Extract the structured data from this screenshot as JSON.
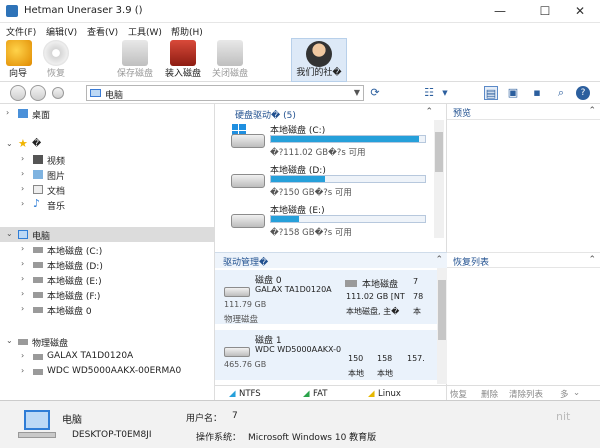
{
  "window": {
    "title": "Hetman Uneraser 3.9 ()",
    "min": "—",
    "max": "☐",
    "close": "✕"
  },
  "menu": [
    "文件(F)",
    "编辑(V)",
    "查看(V)",
    "工具(W)",
    "帮助(H)"
  ],
  "toolbar": {
    "wizard": "向导",
    "recover": "恢复",
    "save_disk": "保存磁盘",
    "load_disk": "装入磁盘",
    "close_disk": "关闭磁盘",
    "community": "我们的社�"
  },
  "address": {
    "value": "电脑"
  },
  "tree": {
    "desktop": "桌面",
    "favorites": "�",
    "videos": "视频",
    "pictures": "图片",
    "documents": "文档",
    "music": "音乐",
    "computer": "电脑",
    "drives": [
      "本地磁盘 (C:)",
      "本地磁盘 (D:)",
      "本地磁盘 (E:)",
      "本地磁盘 (F:)",
      "本地磁盘 0"
    ],
    "physical": "物理磁盘",
    "physical_items": [
      "GALAX TA1D0120A",
      "WDC WD5000AAKX-00ERMA0"
    ]
  },
  "hdd_section": {
    "title": "硬盘驱动� (5)"
  },
  "drives": [
    {
      "name": "本地磁盘 (C:)",
      "free": "�?111.02 GB�?s 可用",
      "used": 0.96
    },
    {
      "name": "本地磁盘 (D:)",
      "free": "�?150 GB�?s 可用",
      "used": 0.35
    },
    {
      "name": "本地磁盘 (E:)",
      "free": "�?158 GB�?s 可用",
      "used": 0.18
    }
  ],
  "drive_mgr": {
    "title": "驱动管理�"
  },
  "disks": [
    {
      "n1": "磁盘 0",
      "n2": "GALAX TA1D0120A",
      "size": "111.79 GB",
      "type": "物理磁盘",
      "p1name": "本地磁盘",
      "p1size": "111.02 GB [NT",
      "p1cap": "本地磁盘, 主�",
      "p2a": "7",
      "p2b": "78",
      "p2c": "本"
    },
    {
      "n1": "磁盘 1",
      "n2": "WDC WD5000AAKX-0",
      "size": "465.76 GB",
      "type": "",
      "p1name": "",
      "p1size": "150",
      "p1cap": "本地",
      "p2a": "158",
      "p2b": "157.",
      "p2c": "本地"
    }
  ],
  "legend": {
    "ntfs": "NTFS",
    "fat": "FAT",
    "linux": "Linux"
  },
  "preview": {
    "title": "预览"
  },
  "recovery": {
    "title": "恢复列表"
  },
  "recovery_btns": {
    "recover": "恢复",
    "delete": "删除",
    "clear": "清除列表",
    "more": "多"
  },
  "status": {
    "pc_name": "电脑",
    "host": "DESKTOP-T0EM8JI",
    "user_label": "用户名：",
    "user": "7",
    "os_label": "操作系统：",
    "os": "Microsoft Windows 10 教育版"
  },
  "watermark": "nit",
  "colors": {
    "bar": "#26a0da",
    "accent": "#1f4f8f"
  }
}
